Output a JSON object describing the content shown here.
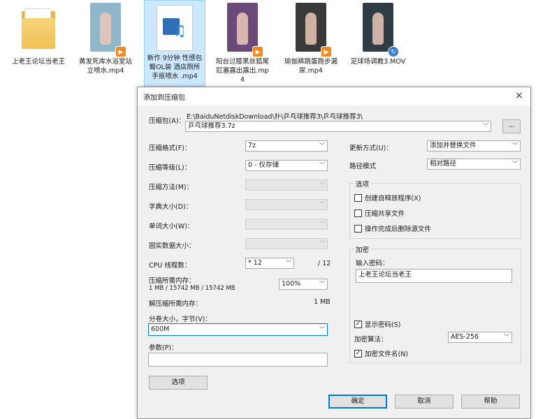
{
  "desktop": {
    "files": [
      {
        "name": "上老王论坛当老王",
        "kind": "folder"
      },
      {
        "name": "黄发死库水浴室站立喷水.mp4",
        "kind": "video",
        "thumb": "#8fb6c9",
        "badge": "▶"
      },
      {
        "name": "新作 9分钟 性感包臀OL装 酒店厕所手抠喷水 .mp4",
        "kind": "media"
      },
      {
        "name": "阳台过膝黑丝狐尾肛塞露出露出.mp4",
        "kind": "video",
        "thumb": "#6b4a7a",
        "badge": "▶"
      },
      {
        "name": "瑜伽裤跳蛋跑步漏尿.mp4",
        "kind": "video",
        "thumb": "#3a3a3a",
        "badge": "▶"
      },
      {
        "name": "足球场调教3.MOV",
        "kind": "video",
        "thumb": "#2f3b45",
        "badge": "↻"
      }
    ]
  },
  "dialog": {
    "title": "添加到压缩包",
    "close_icon": "×",
    "archive_label": "压缩包(A)：",
    "archive_path": "E:\\BaiduNetdiskDownload\\扑\\乒乓球推荐3\\乒乓球推荐3\\",
    "archive_name": "乒乓球推荐3.7z",
    "browse_label": "...",
    "format_label": "压缩格式(F)：",
    "format_value": "7z",
    "level_label": "压缩等级(L)：",
    "level_value": "0 - 仅存储",
    "method_label": "压缩方法(M)：",
    "dict_label": "字典大小(D)：",
    "word_label": "单词大小(W)：",
    "solid_label": "固实数据大小：",
    "cpu_label": "CPU 线程数：",
    "cpu_value": "* 12",
    "cpu_total": "/ 12",
    "mem_compress_label": "压缩所需内存：",
    "mem_compress_detail": "1 MB / 15742 MB / 15742 MB",
    "mem_percent": "100%",
    "mem_decompress_label": "解压缩所需内存：",
    "mem_decompress_value": "1 MB",
    "volume_label": "分卷大小，字节(V)：",
    "volume_value": "600M",
    "params_label": "参数(P)：",
    "params_value": "",
    "options_button": "选项",
    "update_label": "更新方式(U)：",
    "update_value": "添加并替换文件",
    "path_label": "路径模式",
    "path_value": "相对路径",
    "options_group": "选项",
    "opt_sfx": "创建自释放程序(X)",
    "opt_shared": "压缩共享文件",
    "opt_delete": "操作完成后删除源文件",
    "encrypt_group": "加密",
    "password_label": "输入密码：",
    "password_value": "上老王论坛当老王",
    "show_password": "显示密码(S)",
    "enc_method_label": "加密算法：",
    "enc_method_value": "AES-256",
    "encrypt_names": "加密文件名(N)",
    "ok_button": "确定",
    "cancel_button": "取消",
    "help_button": "帮助"
  }
}
